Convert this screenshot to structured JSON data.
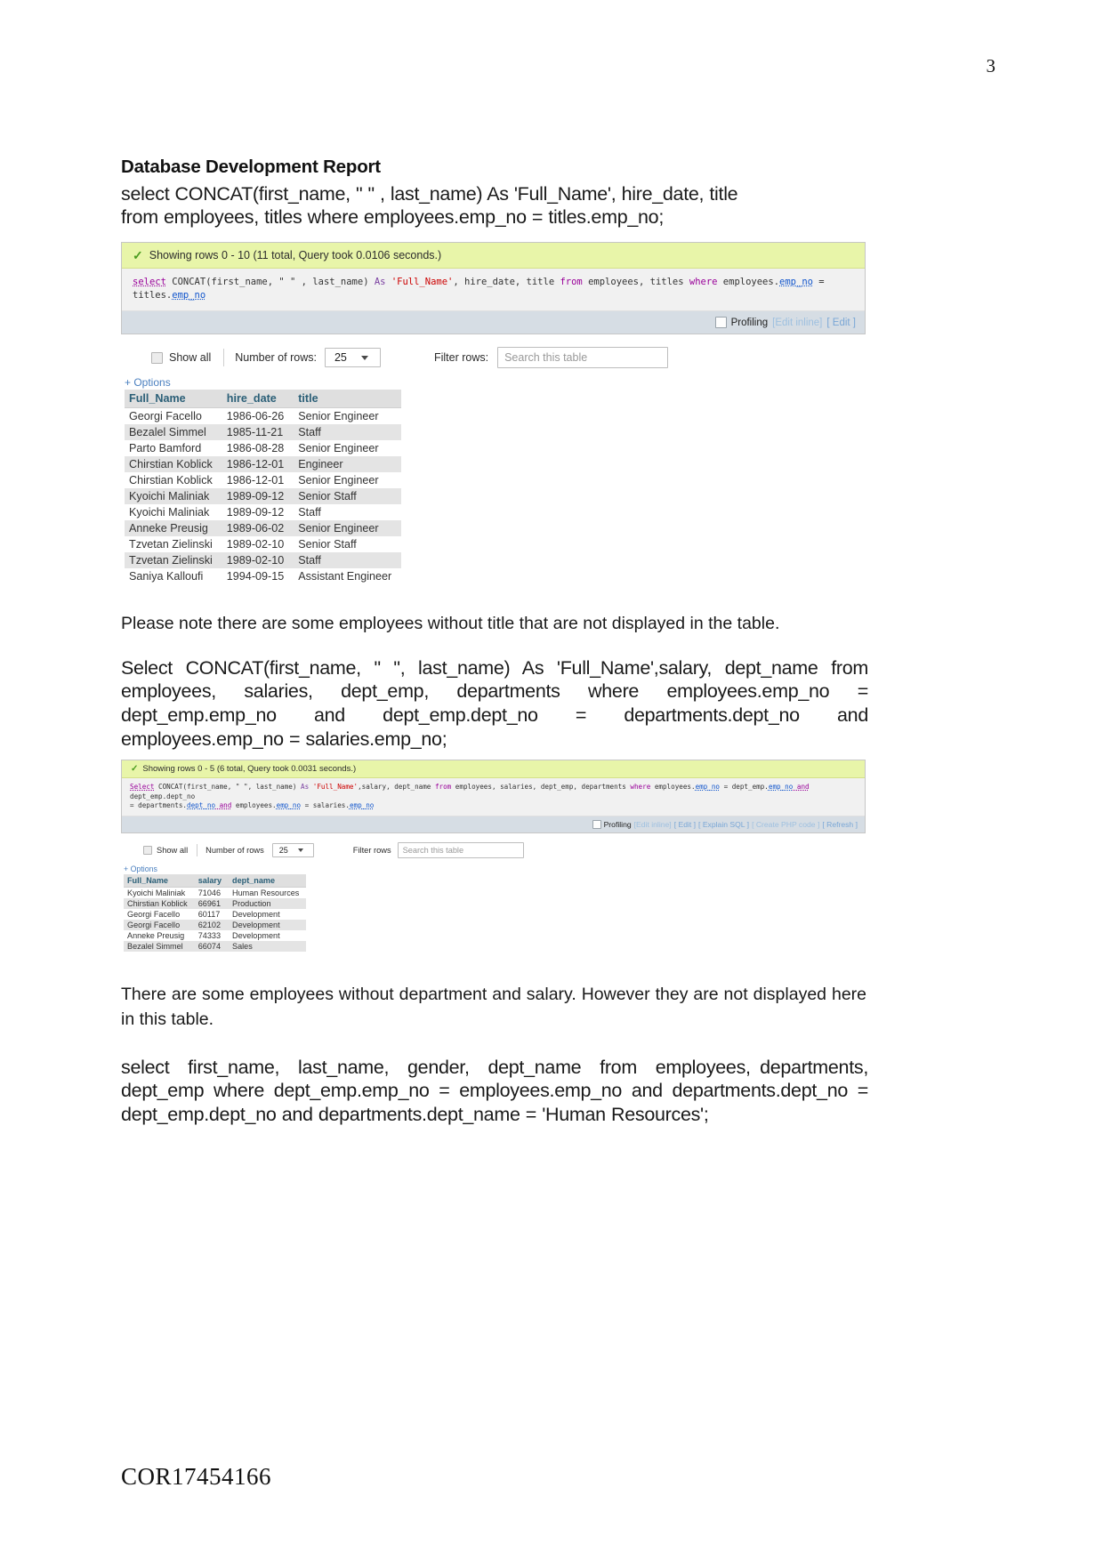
{
  "page": {
    "number": "3",
    "footer_code": "COR17454166"
  },
  "document": {
    "title": "Database Development Report"
  },
  "query1": {
    "text": "select CONCAT(first_name, \" \" , last_name) As 'Full_Name', hire_date, title\nfrom employees, titles where employees.emp_no = titles.emp_no;",
    "result": {
      "status": "Showing rows 0 - 10 (11 total, Query took 0.0106 seconds.)",
      "echo_parts": {
        "p1": "select",
        "p2": " CONCAT(first_name, \" \" , last_name) ",
        "p3": "As",
        "p4": " 'Full_Name'",
        "p5": ", hire_date, title ",
        "p6": "from",
        "p7": " employees, titles ",
        "p8": "where",
        "p9": " employees.",
        "p10": "emp_no",
        "p11": " = titles.",
        "p12": "emp_no"
      },
      "profiling_label": "Profiling",
      "links": [
        "[Edit inline]",
        "[ Edit ]"
      ],
      "toolbar": {
        "show_all": "Show all",
        "number_of_rows_label": "Number of rows:",
        "rows_value": "25",
        "filter_label": "Filter rows:",
        "filter_placeholder": "Search this table"
      },
      "options_label": "+ Options",
      "columns": [
        "Full_Name",
        "hire_date",
        "title"
      ],
      "rows": [
        [
          "Georgi Facello",
          "1986-06-26",
          "Senior Engineer"
        ],
        [
          "Bezalel Simmel",
          "1985-11-21",
          "Staff"
        ],
        [
          "Parto Bamford",
          "1986-08-28",
          "Senior Engineer"
        ],
        [
          "Chirstian Koblick",
          "1986-12-01",
          "Engineer"
        ],
        [
          "Chirstian Koblick",
          "1986-12-01",
          "Senior Engineer"
        ],
        [
          "Kyoichi Maliniak",
          "1989-09-12",
          "Senior Staff"
        ],
        [
          "Kyoichi Maliniak",
          "1989-09-12",
          "Staff"
        ],
        [
          "Anneke Preusig",
          "1989-06-02",
          "Senior Engineer"
        ],
        [
          "Tzvetan Zielinski",
          "1989-02-10",
          "Senior Staff"
        ],
        [
          "Tzvetan Zielinski",
          "1989-02-10",
          "Staff"
        ],
        [
          "Saniya Kalloufi",
          "1994-09-15",
          "Assistant Engineer"
        ]
      ]
    }
  },
  "note1": "Please note there are some employees without title that are not displayed in the table.",
  "query2": {
    "text": "Select CONCAT(first_name, \" \", last_name) As 'Full_Name',salary, dept_name from employees, salaries, dept_emp, departments where employees.emp_no = dept_emp.emp_no and dept_emp.dept_no = departments.dept_no and employees.emp_no = salaries.emp_no;",
    "result": {
      "status": "Showing rows 0 - 5 (6 total, Query took 0.0031 seconds.)",
      "echo_parts": {
        "p1": "Select",
        "p2": " CONCAT(first_name, \" \", last_name) ",
        "p3": "As",
        "p4": " 'Full_Name'",
        "p5": ",salary, dept_name ",
        "p6": "from",
        "p7": " employees, salaries, dept_emp, departments ",
        "p8": "where",
        "p9": " employees.",
        "p10": "emp_no",
        "p11": " = dept_emp.",
        "p12": "emp_no",
        "p13": " and",
        "p14": " dept_emp.dept_no\n= departments.",
        "p15": "dept_no",
        "p16": " and",
        "p17": " employees.",
        "p18": "emp_no",
        "p19": " = salaries.",
        "p20": "emp_no"
      },
      "profiling_label": "Profiling",
      "links": [
        "[Edit inline]",
        "[ Edit ]",
        "[ Explain SQL ]",
        "[ Create PHP code ]",
        "[ Refresh ]"
      ],
      "toolbar": {
        "show_all": "Show all",
        "number_of_rows_label": "Number of rows",
        "rows_value": "25",
        "filter_label": "Filter rows",
        "filter_placeholder": "Search this table"
      },
      "options_label": "+ Options",
      "columns": [
        "Full_Name",
        "salary",
        "dept_name"
      ],
      "rows": [
        [
          "Kyoichi Maliniak",
          "71046",
          "Human Resources"
        ],
        [
          "Chirstian Koblick",
          "66961",
          "Production"
        ],
        [
          "Georgi Facello",
          "60117",
          "Development"
        ],
        [
          "Georgi Facello",
          "62102",
          "Development"
        ],
        [
          "Anneke Preusig",
          "74333",
          "Development"
        ],
        [
          "Bezalel Simmel",
          "66074",
          "Sales"
        ]
      ]
    }
  },
  "note2": "There are some employees without department and salary. However they are not displayed here in this table.",
  "query3": {
    "text": "select  first_name,  last_name,  gender,  dept_name  from  employees, departments, dept_emp where dept_emp.emp_no = employees.emp_no and departments.dept_no = dept_emp.dept_no and departments.dept_name = 'Human Resources';"
  }
}
